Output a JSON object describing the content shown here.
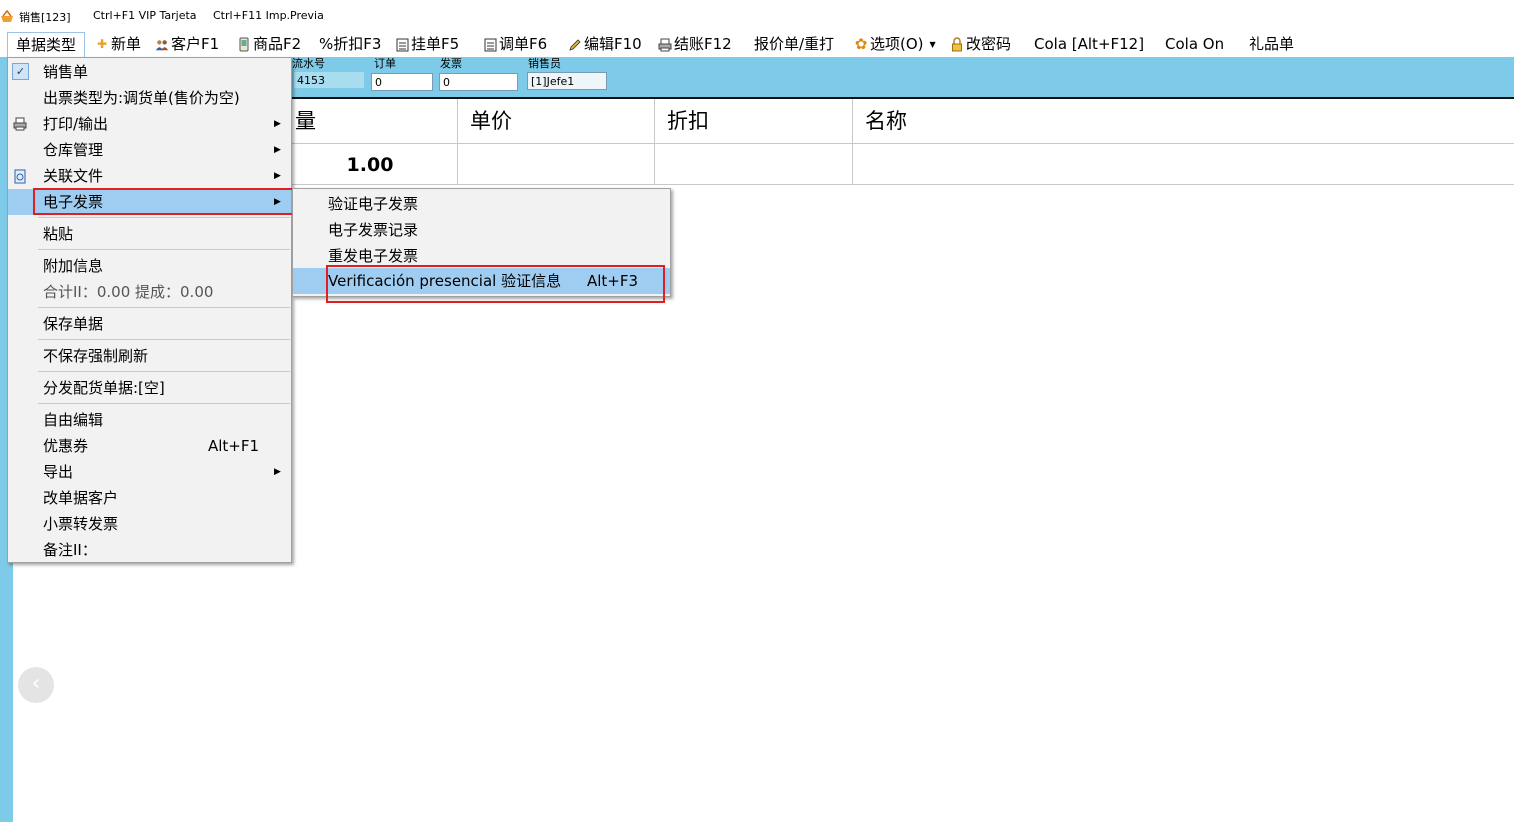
{
  "titlebar": {
    "title": "销售[123]",
    "hint1": "Ctrl+F1 VIP Tarjeta",
    "hint2": "Ctrl+F11 Imp.Previa"
  },
  "toolbar": {
    "bill_type": "单据类型",
    "new_bill": "新单",
    "customer": "客户F1",
    "product": "商品F2",
    "discount": "%折扣F3",
    "hold": "挂单F5",
    "recall": "调单F6",
    "edit": "编辑F10",
    "checkout": "结账F12",
    "quote": "报价单/重打",
    "options": "选项(O)",
    "password": "改密码",
    "cola": "Cola [Alt+F12]",
    "cola_on": "Cola On",
    "gift": "礼品单"
  },
  "header_fields": {
    "serial_label": "流水号",
    "serial_value": "4153",
    "order_label": "订单",
    "order_value": "0",
    "invoice_label": "发票",
    "invoice_value": "0",
    "seller_label": "销售员",
    "seller_value": "[1]Jefe1"
  },
  "grid": {
    "columns": [
      "量",
      "单价",
      "折扣",
      "名称"
    ],
    "row": {
      "qty": "1.00"
    }
  },
  "menu": {
    "sales_bill": "销售单",
    "ticket_type": "出票类型为:调货单(售价为空)",
    "print_output": "打印/输出",
    "warehouse": "仓库管理",
    "linked_files": "关联文件",
    "einvoice": "电子发票",
    "paste": "粘贴",
    "extra_info": "附加信息",
    "totals": "合计II：0.00   提成：0.00",
    "save_bill": "保存单据",
    "force_refresh": "不保存强制刷新",
    "distribute": "分发配货单据:[空]",
    "free_edit": "自由编辑",
    "coupon": "优惠券",
    "coupon_shortcut": "Alt+F1",
    "export": "导出",
    "change_customer": "改单据客户",
    "ticket_to_invoice": "小票转发票",
    "remark": "备注II："
  },
  "submenu": {
    "verify_einvoice": "验证电子发票",
    "einvoice_records": "电子发票记录",
    "resend_einvoice": "重发电子发票",
    "verification": "Verificación presencial 验证信息",
    "verification_shortcut": "Alt+F3"
  },
  "colors": {
    "band": "#7ecbe9",
    "highlight": "#9fcdf2",
    "annotation": "#e02020"
  },
  "icons": [
    "cart-icon",
    "plus-icon",
    "people-icon",
    "phone-icon",
    "clipboard-icon",
    "pencil-icon",
    "printer-icon",
    "gear-icon",
    "lock-icon",
    "document-icon",
    "chevron-right-icon",
    "check-icon",
    "back-arrow-icon"
  ]
}
